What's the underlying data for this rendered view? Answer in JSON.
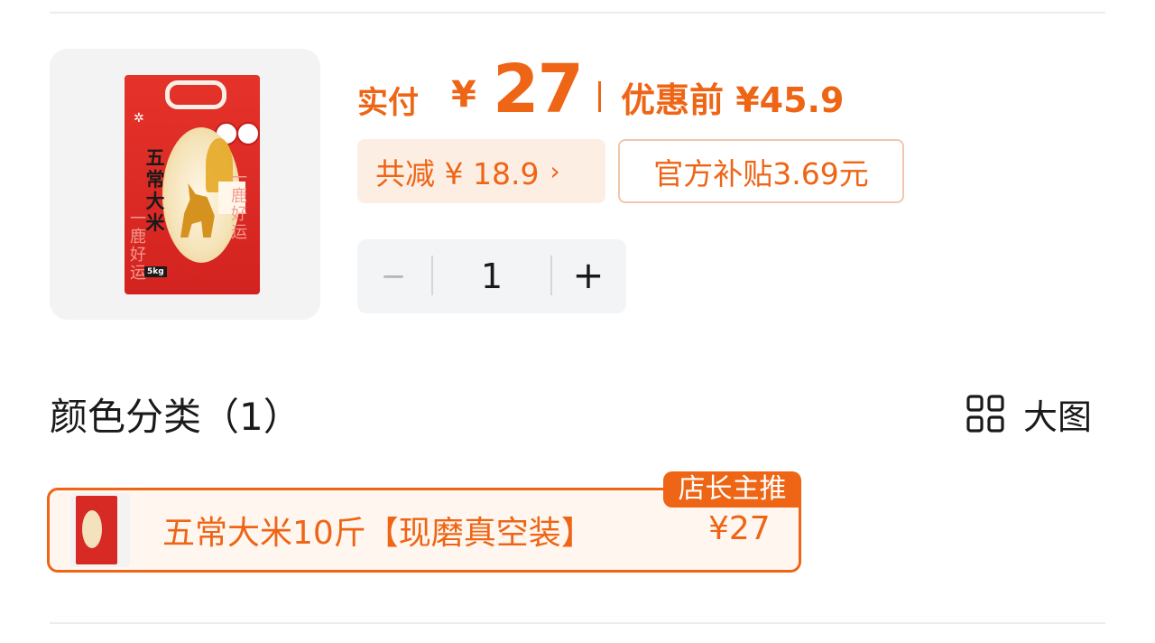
{
  "product": {
    "image_alt": "五常大米 rice bag",
    "bag": {
      "title_text": "五常大米",
      "side_text": "一鹿好运",
      "weight_badge": "5kg"
    }
  },
  "price": {
    "pay_label": "实付",
    "currency": "¥",
    "pay_amount": "27",
    "original_label": "优惠前 ¥45.9"
  },
  "discount": {
    "total_label": "共减 ¥ 18.9",
    "arrow": "›",
    "subsidy_label": "官方补贴3.69元"
  },
  "quantity": {
    "minus": "−",
    "value": "1",
    "plus": "+"
  },
  "variants": {
    "title": "颜色分类（1）",
    "view_label": "大图",
    "items": [
      {
        "label": "五常大米10斤【现磨真空装】",
        "price": "¥27",
        "tag": "店长主推"
      }
    ]
  },
  "colors": {
    "accent": "#ee6516",
    "chip_bg": "#fdeee4",
    "stepper_bg": "#f3f4f6"
  }
}
